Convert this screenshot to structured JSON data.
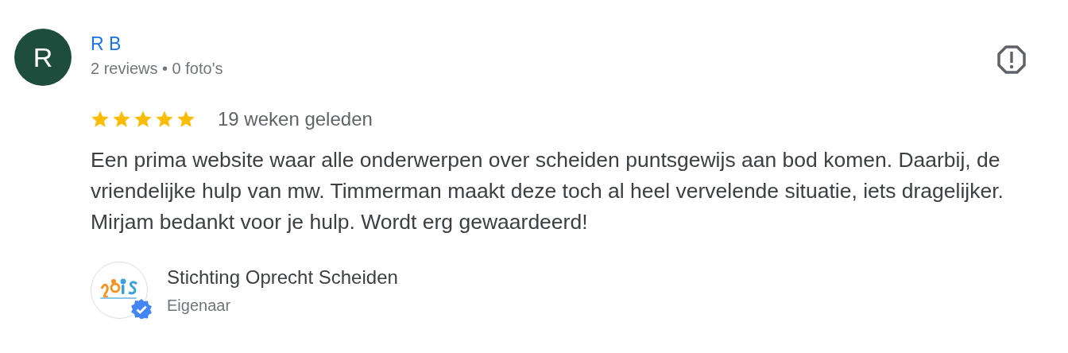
{
  "review": {
    "author": {
      "initial": "R",
      "name": "R B",
      "meta": "2 reviews • 0 foto's"
    },
    "stars": 5,
    "time": "19 weken geleden",
    "text": "Een prima website waar alle onderwerpen over scheiden puntsgewijs aan bod komen. Daarbij, de vriendelijke hulp van mw. Timmerman maakt deze toch al heel vervelende situatie, iets dragelijker. Mirjam bedankt voor je hulp. Wordt erg gewaardeerd!",
    "owner": {
      "verified": true,
      "name": "Stichting Oprecht Scheiden",
      "role": "Eigenaar"
    }
  }
}
